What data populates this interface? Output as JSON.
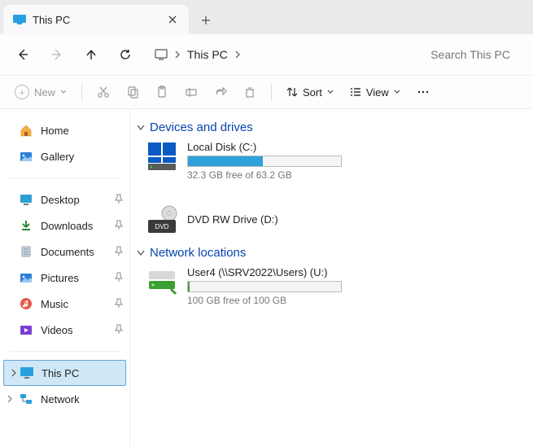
{
  "tab": {
    "title": "This PC"
  },
  "breadcrumbs": {
    "current": "This PC"
  },
  "search": {
    "placeholder": "Search This PC"
  },
  "toolbar": {
    "new": "New",
    "sort": "Sort",
    "view": "View"
  },
  "sidebar": {
    "home": "Home",
    "gallery": "Gallery",
    "desktop": "Desktop",
    "downloads": "Downloads",
    "documents": "Documents",
    "pictures": "Pictures",
    "music": "Music",
    "videos": "Videos",
    "thispc": "This PC",
    "network": "Network"
  },
  "sections": {
    "devices": "Devices and drives",
    "network": "Network locations"
  },
  "drives": {
    "local": {
      "name": "Local Disk (C:)",
      "free": "32.3 GB free of 63.2 GB",
      "fillpct": 49
    },
    "dvd": {
      "name": "DVD RW Drive (D:)"
    },
    "net": {
      "name": "User4 (\\\\SRV2022\\Users) (U:)",
      "free": "100 GB free of 100 GB",
      "fillpct": 1
    }
  }
}
